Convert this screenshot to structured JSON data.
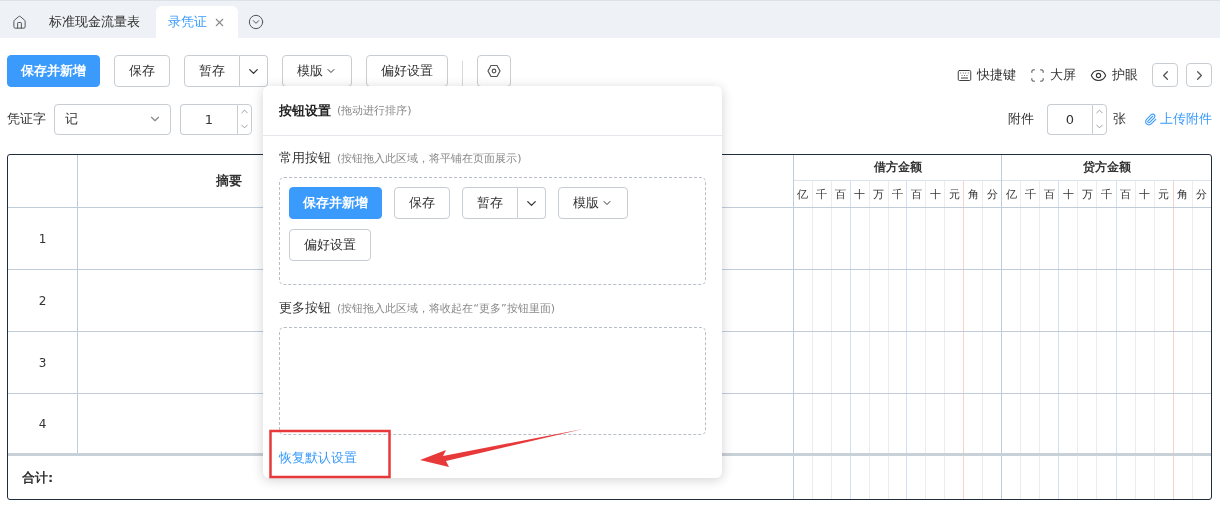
{
  "tab_bar": {
    "tabs": [
      {
        "label": "标准现金流量表",
        "selected": false,
        "closable": false
      },
      {
        "label": "录凭证",
        "selected": true,
        "closable": true
      }
    ]
  },
  "toolbar": {
    "buttons": [
      {
        "label": "保存并新增",
        "kind": "primary"
      },
      {
        "label": "保存",
        "kind": "default"
      },
      {
        "label": "暂存",
        "kind": "split"
      },
      {
        "label": "模版",
        "kind": "dropdown"
      },
      {
        "label": "偏好设置",
        "kind": "default"
      }
    ],
    "tools": [
      {
        "label": "快捷键",
        "kind": "keyboard"
      },
      {
        "label": "大屏",
        "kind": "fullscreen"
      },
      {
        "label": "护眼",
        "kind": "eye"
      }
    ]
  },
  "voucher": {
    "word_label": "凭证字",
    "word_value": "记",
    "number_value": "1",
    "attachment_label": "附件",
    "attachment_value": "0",
    "attachment_unit": "张",
    "upload_link": "上传附件"
  },
  "table": {
    "summary_header": "摘要",
    "debit": {
      "title": "借方金额",
      "digits": [
        "亿",
        "千",
        "百",
        "十",
        "万",
        "千",
        "百",
        "十",
        "元",
        "角",
        "分"
      ]
    },
    "credit": {
      "title": "贷方金额",
      "digits": [
        "亿",
        "千",
        "百",
        "十",
        "万",
        "千",
        "百",
        "十",
        "元",
        "角",
        "分"
      ]
    },
    "rows": [
      "1",
      "2",
      "3",
      "4"
    ],
    "total_label": "合计:"
  },
  "popover": {
    "title": "按钮设置",
    "hint": "(拖动进行排序)",
    "sections": [
      {
        "title": "常用按钮",
        "hint": "(按钮拖入此区域，将平铺在页面展示)",
        "buttons": [
          {
            "label": "保存并新增",
            "kind": "primary"
          },
          {
            "label": "保存",
            "kind": "default"
          },
          {
            "label": "暂存",
            "kind": "split"
          },
          {
            "label": "模版",
            "kind": "dropdown"
          },
          {
            "label": "偏好设置",
            "kind": "default"
          }
        ]
      },
      {
        "title": "更多按钮",
        "hint": "(按钮拖入此区域，将收起在“更多”按钮里面)"
      }
    ],
    "reset_link": "恢复默认设置"
  }
}
